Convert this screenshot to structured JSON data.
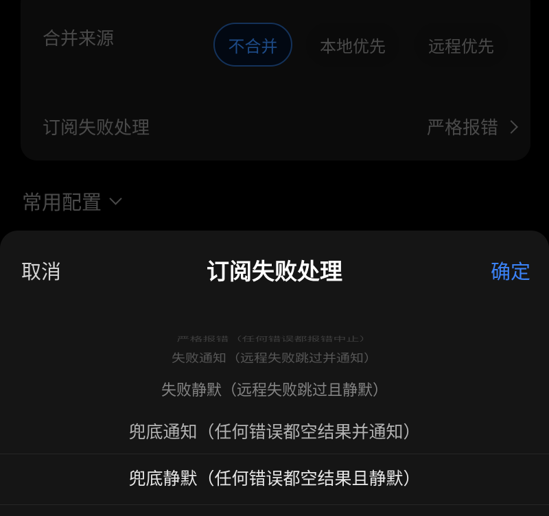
{
  "settings": {
    "merge_source": {
      "label": "合并来源",
      "options": [
        "不合并",
        "本地优先",
        "远程优先"
      ],
      "selected": "不合并"
    },
    "subscription_failure": {
      "label": "订阅失败处理",
      "value": "严格报错"
    },
    "common_config": {
      "label": "常用配置"
    }
  },
  "sheet": {
    "cancel_label": "取消",
    "title": "订阅失败处理",
    "confirm_label": "确定",
    "options": [
      "严格报错（任何错误都报错中止）",
      "失败通知（远程失败跳过并通知）",
      "失败静默（远程失败跳过且静默）",
      "兜底通知（任何错误都空结果并通知）",
      "兜底静默（任何错误都空结果且静默）"
    ],
    "selected": "兜底静默（任何错误都空结果且静默）"
  },
  "colors": {
    "accent": "#3b82f6",
    "sheet_background": "#151515",
    "page_background": "#000000"
  },
  "icons": {
    "fail_value_chevron": "chevron-right-icon",
    "common_config_chevron": "chevron-down-icon"
  }
}
